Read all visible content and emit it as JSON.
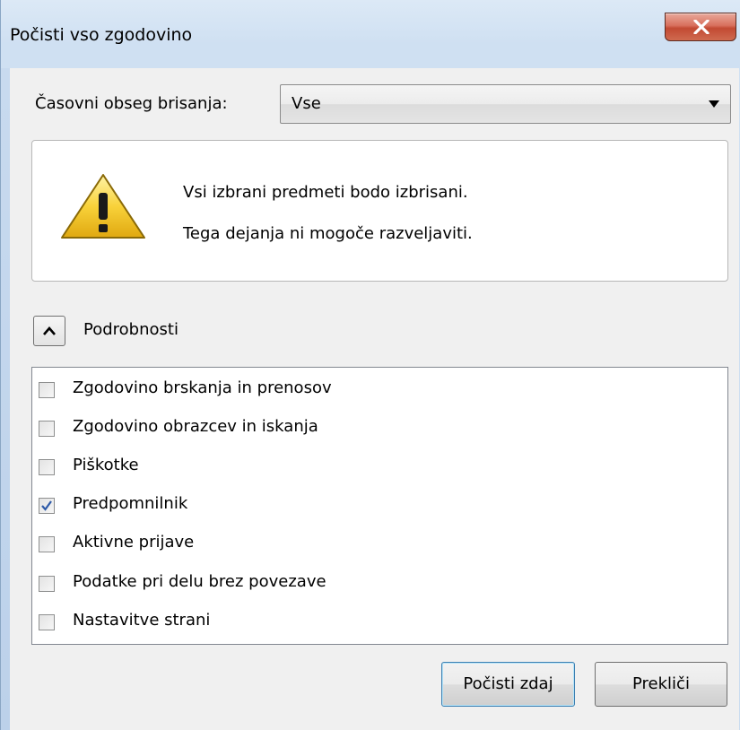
{
  "window": {
    "title": "Počisti vso zgodovino",
    "close_label": "X"
  },
  "time_range": {
    "label": "Časovni obseg brisanja:",
    "selected": "Vse"
  },
  "warning": {
    "line1": "Vsi izbrani predmeti bodo izbrisani.",
    "line2": "Tega dejanja ni mogoče razveljaviti."
  },
  "details": {
    "label": "Podrobnosti",
    "items": [
      {
        "label": "Zgodovino brskanja in prenosov",
        "checked": false
      },
      {
        "label": "Zgodovino obrazcev in iskanja",
        "checked": false
      },
      {
        "label": "Piškotke",
        "checked": false
      },
      {
        "label": "Predpomnilnik",
        "checked": true
      },
      {
        "label": "Aktivne prijave",
        "checked": false
      },
      {
        "label": "Podatke pri delu brez povezave",
        "checked": false
      },
      {
        "label": "Nastavitve strani",
        "checked": false
      }
    ]
  },
  "buttons": {
    "clear_now": "Počisti zdaj",
    "cancel": "Prekliči"
  },
  "colors": {
    "accent_border": "#3c7fb1",
    "close_red": "#c24a33",
    "check_blue": "#2e5aa8"
  }
}
